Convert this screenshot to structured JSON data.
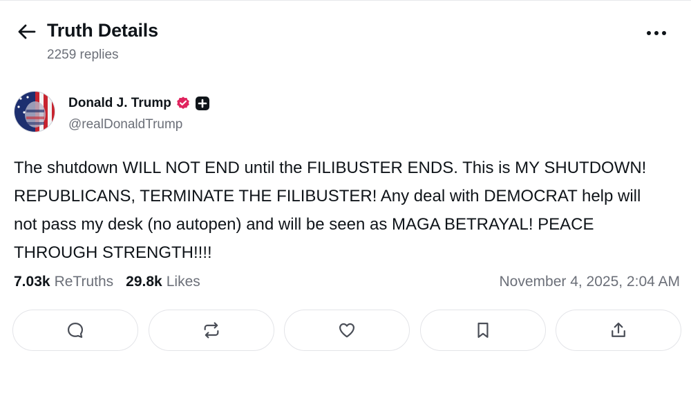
{
  "header": {
    "title": "Truth Details",
    "subtitle": "2259 replies",
    "back_icon": "arrow-left-icon",
    "more_icon": "more-horizontal-icon"
  },
  "author": {
    "name": "Donald J. Trump",
    "handle": "@realDonaldTrump",
    "verified_icon": "verified-badge-icon",
    "verified_color": "#e0245e",
    "plus_icon": "plus-square-icon"
  },
  "post": {
    "text": "The shutdown WILL NOT END until the FILIBUSTER ENDS. This is MY SHUTDOWN! REPUBLICANS, TERMINATE THE FILIBUSTER! Any deal with DEMOCRAT help will not pass my desk (no autopen) and will be seen as MAGA BETRAYAL! PEACE THROUGH STRENGTH!!!!",
    "retruths_count": "7.03k",
    "retruths_label": "ReTruths",
    "likes_count": "29.8k",
    "likes_label": "Likes",
    "timestamp": "November 4, 2025, 2:04 AM"
  },
  "actions": [
    {
      "name": "reply",
      "icon": "comment-icon"
    },
    {
      "name": "retruth",
      "icon": "repost-icon"
    },
    {
      "name": "like",
      "icon": "heart-icon"
    },
    {
      "name": "bookmark",
      "icon": "bookmark-icon"
    },
    {
      "name": "share",
      "icon": "share-icon"
    }
  ],
  "colors": {
    "text_primary": "#0f1419",
    "text_secondary": "#6b6f78",
    "border": "#e3e4e8"
  }
}
